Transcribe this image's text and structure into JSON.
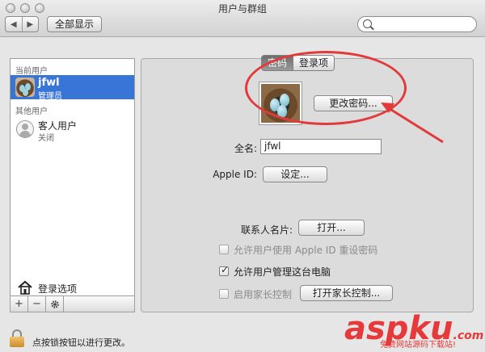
{
  "window": {
    "title": "用户与群组"
  },
  "toolbar": {
    "back": "◀",
    "forward": "▶",
    "show_all": "全部显示",
    "search_placeholder": ""
  },
  "sidebar": {
    "current_users_header": "当前用户",
    "current_user": {
      "name": "jfwl",
      "role": "管理员"
    },
    "other_users_header": "其他用户",
    "guest_user": {
      "name": "客人用户",
      "status": "关闭"
    },
    "login_options": "登录选项",
    "add_button": "+",
    "remove_button": "−"
  },
  "tabs": [
    {
      "label": "密码",
      "selected": true
    },
    {
      "label": "登录项",
      "selected": false
    }
  ],
  "panel": {
    "change_password_button": "更改密码...",
    "full_name_label": "全名:",
    "full_name_value": "jfwl",
    "apple_id_label": "Apple ID:",
    "set_button": "设定...",
    "contact_card_label": "联系人名片:",
    "open_button": "打开...",
    "checkboxes": [
      {
        "label": "允许用户使用 Apple ID 重设密码",
        "checked": false,
        "enabled": false
      },
      {
        "label": "允许用户管理这台电脑",
        "checked": true,
        "enabled": true
      },
      {
        "label": "启用家长控制",
        "checked": false,
        "enabled": false
      }
    ],
    "parental_controls_button": "打开家长控制..."
  },
  "footer": {
    "lock_text": "点按锁按钮以进行更改。"
  },
  "watermark": {
    "brand": "aspku",
    "suffix": ".com",
    "sub": "免费网站源码下载站!"
  },
  "colors": {
    "selection": "#3875d7",
    "annotation": "#e23a3a",
    "watermark": "#e63a3a"
  },
  "icons": [
    "back-icon",
    "forward-icon",
    "search-icon",
    "avatar-bird-nest",
    "guest-icon",
    "house-icon",
    "gear-icon",
    "lock-icon"
  ]
}
